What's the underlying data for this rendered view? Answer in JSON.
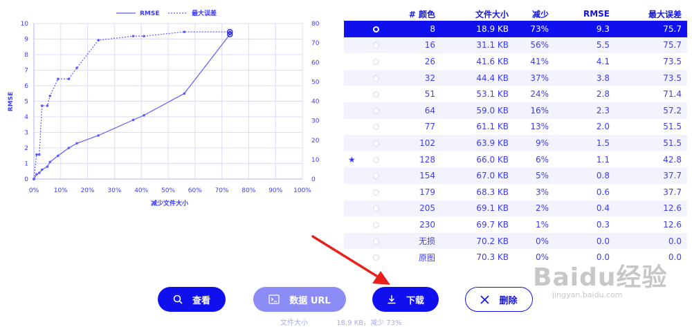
{
  "chart_data": {
    "type": "line",
    "xlabel": "减少文件大小",
    "ylabel_left": "RMSE",
    "ylabel_right": "最大误差",
    "xlim": [
      0,
      100
    ],
    "ylim_left": [
      0,
      10
    ],
    "ylim_right": [
      0,
      80
    ],
    "x_ticks": [
      "0%",
      "10%",
      "20%",
      "30%",
      "40%",
      "50%",
      "60%",
      "70%",
      "80%",
      "90%",
      "100%"
    ],
    "y_ticks_left": [
      "0",
      "1",
      "2",
      "3",
      "4",
      "5",
      "6",
      "7",
      "8",
      "9",
      "10"
    ],
    "y_ticks_right": [
      "0",
      "10",
      "20",
      "30",
      "40",
      "50",
      "60",
      "70",
      "80"
    ],
    "grid": true,
    "legend_position": "top-center",
    "series": [
      {
        "name": "RMSE",
        "axis": "left",
        "style": "solid",
        "x": [
          0,
          0,
          1,
          2,
          3,
          5,
          6,
          9,
          13,
          16,
          24,
          37,
          41,
          56,
          73
        ],
        "y": [
          0.0,
          0.0,
          0.3,
          0.4,
          0.6,
          0.8,
          1.1,
          1.5,
          2.0,
          2.3,
          2.8,
          3.8,
          4.1,
          5.5,
          9.3
        ]
      },
      {
        "name": "最大误差",
        "axis": "right",
        "style": "dotted",
        "x": [
          0,
          0,
          1,
          2,
          3,
          5,
          6,
          9,
          13,
          16,
          24,
          37,
          41,
          56,
          73
        ],
        "y": [
          0.0,
          0.0,
          12.6,
          12.6,
          37.7,
          37.7,
          42.8,
          51.5,
          51.5,
          57.2,
          71.4,
          73.5,
          73.5,
          75.7,
          75.7
        ]
      }
    ]
  },
  "table": {
    "headers": [
      "",
      "",
      "# 颜色",
      "文件大小",
      "减少",
      "RMSE",
      "最大误差"
    ],
    "rows": [
      {
        "star": "",
        "colors": "8",
        "size": "18.9 KB",
        "reduce": "73%",
        "rmse": "9.3",
        "maxerr": "75.7",
        "selected": true
      },
      {
        "star": "",
        "colors": "16",
        "size": "31.1 KB",
        "reduce": "56%",
        "rmse": "5.5",
        "maxerr": "75.7"
      },
      {
        "star": "",
        "colors": "26",
        "size": "41.6 KB",
        "reduce": "41%",
        "rmse": "4.1",
        "maxerr": "73.5"
      },
      {
        "star": "",
        "colors": "32",
        "size": "44.4 KB",
        "reduce": "37%",
        "rmse": "3.8",
        "maxerr": "73.5"
      },
      {
        "star": "",
        "colors": "51",
        "size": "53.1 KB",
        "reduce": "24%",
        "rmse": "2.8",
        "maxerr": "71.4"
      },
      {
        "star": "",
        "colors": "64",
        "size": "59.0 KB",
        "reduce": "16%",
        "rmse": "2.3",
        "maxerr": "57.2"
      },
      {
        "star": "",
        "colors": "77",
        "size": "61.1 KB",
        "reduce": "13%",
        "rmse": "2.0",
        "maxerr": "51.5"
      },
      {
        "star": "",
        "colors": "102",
        "size": "63.9 KB",
        "reduce": "9%",
        "rmse": "1.5",
        "maxerr": "51.5"
      },
      {
        "star": "★",
        "colors": "128",
        "size": "66.0 KB",
        "reduce": "6%",
        "rmse": "1.1",
        "maxerr": "42.8"
      },
      {
        "star": "",
        "colors": "154",
        "size": "67.0 KB",
        "reduce": "5%",
        "rmse": "0.8",
        "maxerr": "37.7"
      },
      {
        "star": "",
        "colors": "179",
        "size": "68.3 KB",
        "reduce": "3%",
        "rmse": "0.6",
        "maxerr": "37.7"
      },
      {
        "star": "",
        "colors": "205",
        "size": "69.1 KB",
        "reduce": "2%",
        "rmse": "0.4",
        "maxerr": "12.6"
      },
      {
        "star": "",
        "colors": "230",
        "size": "69.7 KB",
        "reduce": "1%",
        "rmse": "0.3",
        "maxerr": "12.6"
      },
      {
        "star": "",
        "colors": "无损",
        "size": "70.2 KB",
        "reduce": "0%",
        "rmse": "0.0",
        "maxerr": "0.0"
      },
      {
        "star": "",
        "colors": "原图",
        "size": "70.3 KB",
        "reduce": "0%",
        "rmse": "0.0",
        "maxerr": "0.0"
      }
    ]
  },
  "buttons": {
    "view": "查看",
    "dataurl": "数据 URL",
    "download": "下载",
    "delete": "删除"
  },
  "footer": {
    "label": "文件大小",
    "summary": "18.9 KB，减少 73%"
  },
  "watermark": {
    "logo": "Baidu经验",
    "url": "jingyan.baidu.com"
  },
  "icons": {
    "view": "search-icon",
    "dataurl": "data-url-icon",
    "download": "download-icon",
    "delete": "close-icon",
    "favorite": "star-icon",
    "annotation": "red-arrow-icon"
  },
  "colors": {
    "primary": "#1010ee",
    "line": "#5a5aff",
    "grid": "#dcdcf7",
    "secondary_button": "#8c8cf7",
    "arrow": "#e8201a"
  }
}
